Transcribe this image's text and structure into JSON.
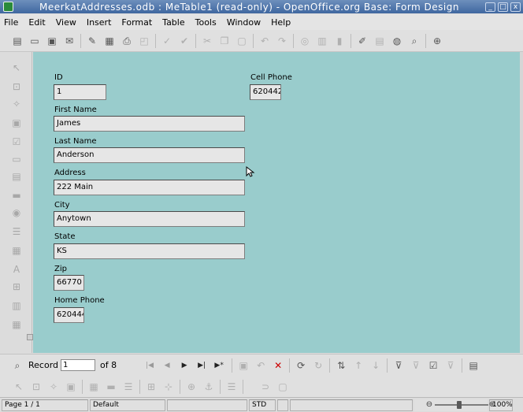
{
  "window": {
    "title": "MeerkatAddresses.odb : MeTable1 (read-only) - OpenOffice.org Base: Form Design"
  },
  "menu": [
    "File",
    "Edit",
    "View",
    "Insert",
    "Format",
    "Table",
    "Tools",
    "Window",
    "Help"
  ],
  "form": {
    "fields": [
      {
        "label": "ID",
        "value": "1"
      },
      {
        "label": "First Name",
        "value": "James"
      },
      {
        "label": "Last Name",
        "value": "Anderson"
      },
      {
        "label": "Address",
        "value": "222 Main"
      },
      {
        "label": "City",
        "value": "Anytown"
      },
      {
        "label": "State",
        "value": "KS"
      },
      {
        "label": "Zip",
        "value": "66770"
      },
      {
        "label": "Home Phone",
        "value": "620444"
      },
      {
        "label": "Cell Phone",
        "value": "620442"
      }
    ]
  },
  "nav": {
    "record_label": "Record",
    "current_record": "1",
    "of_text": "of 8"
  },
  "status": {
    "page": "Page 1 / 1",
    "style": "Default",
    "mode": "STD",
    "zoom": "100%"
  },
  "colors": {
    "form_background": "#99cccc",
    "field_background": "#e6e6e6"
  }
}
